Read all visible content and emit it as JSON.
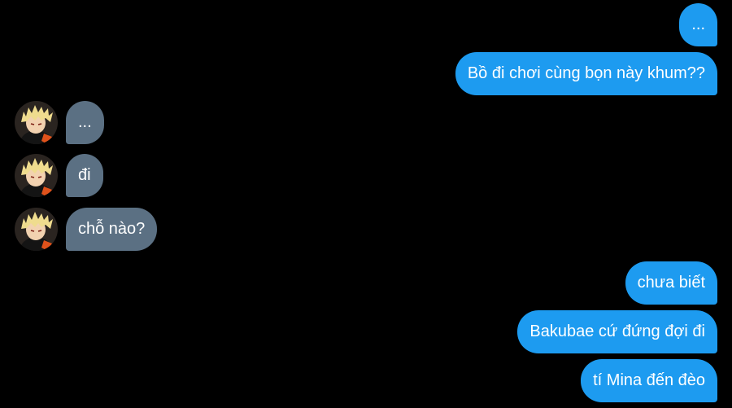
{
  "conversation": {
    "contact": {
      "avatar_icon": "bakugo-avatar-icon"
    },
    "colors": {
      "outgoing_bubble": "#1d9bf0",
      "incoming_bubble": "#5b7083",
      "background": "#000000"
    },
    "messages": [
      {
        "direction": "outgoing",
        "text": "..."
      },
      {
        "direction": "outgoing",
        "text": "Bồ đi chơi cùng bọn này khum??"
      },
      {
        "direction": "incoming",
        "text": "..."
      },
      {
        "direction": "incoming",
        "text": "đi"
      },
      {
        "direction": "incoming",
        "text": "chỗ nào?"
      },
      {
        "direction": "outgoing",
        "text": "chưa biết"
      },
      {
        "direction": "outgoing",
        "text": "Bakubae cứ đứng đợi đi"
      },
      {
        "direction": "outgoing",
        "text": "tí Mina đến đèo"
      }
    ]
  }
}
